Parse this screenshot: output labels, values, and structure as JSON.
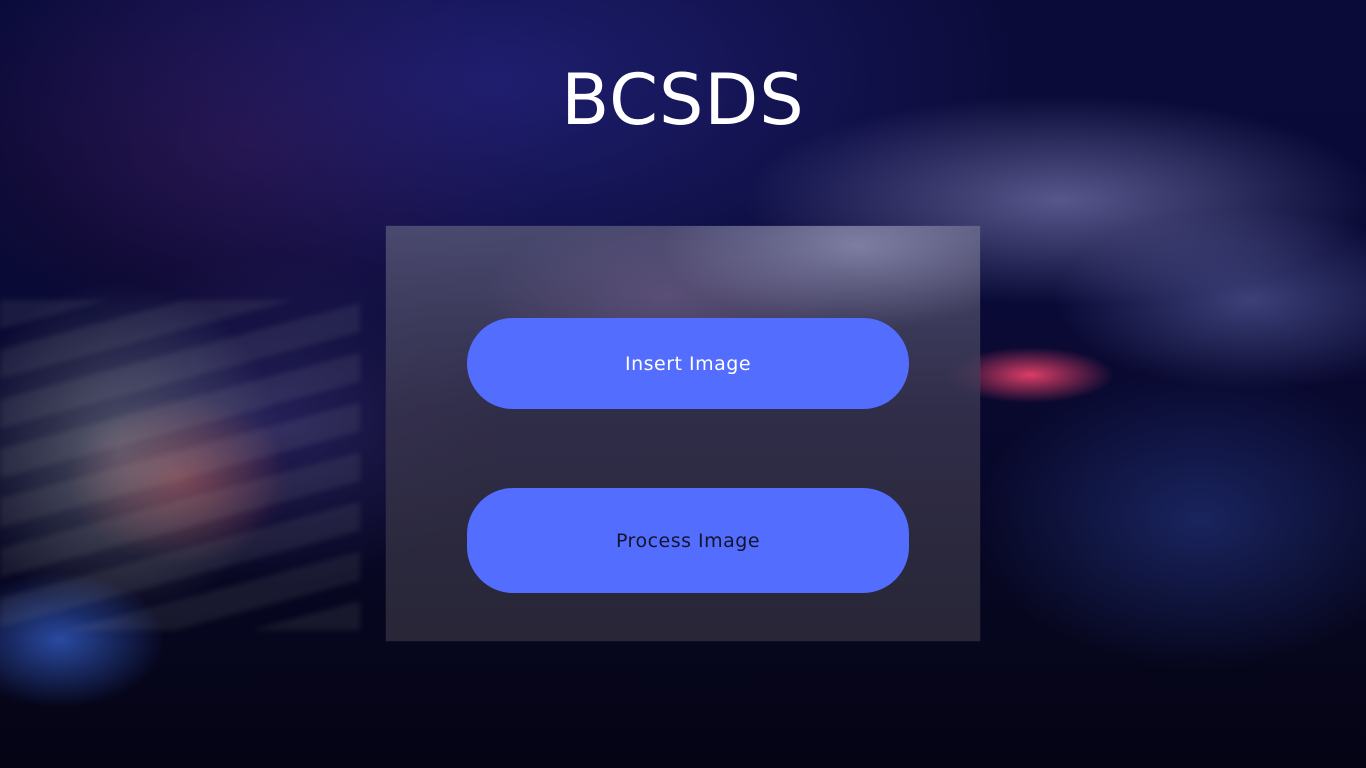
{
  "app": {
    "title": "BCSDS"
  },
  "panel": {
    "insert_button_label": "Insert Image",
    "process_button_label": "Process Image"
  },
  "colors": {
    "button_background": "#536dfe",
    "title_text": "#ffffff",
    "background": "#0b0b3a"
  }
}
